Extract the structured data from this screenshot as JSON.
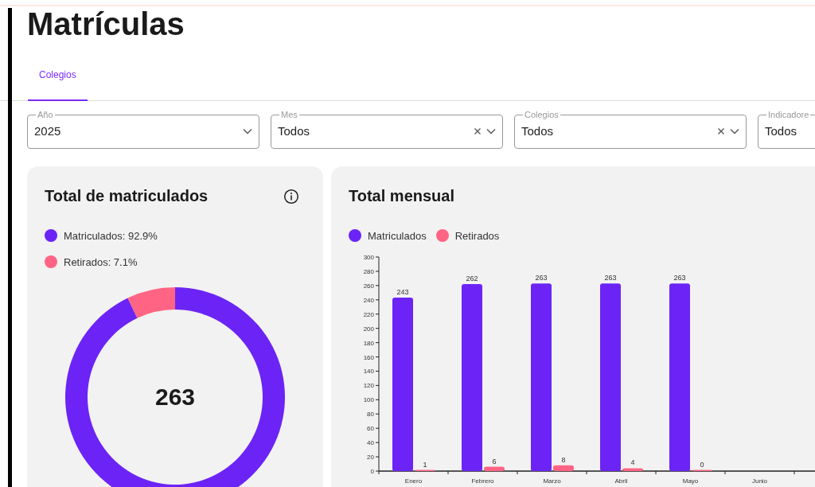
{
  "page": {
    "title": "Matrículas"
  },
  "tabs": [
    {
      "label": "Colegios",
      "selected": true
    }
  ],
  "filters": [
    {
      "label": "Año",
      "value": "2025",
      "clearable": false,
      "dropdown": true
    },
    {
      "label": "Mes",
      "value": "Todos",
      "clearable": true,
      "dropdown": true
    },
    {
      "label": "Colegios",
      "value": "Todos",
      "clearable": true,
      "dropdown": true
    },
    {
      "label": "Indicadore",
      "value": "Todos"
    }
  ],
  "total_card": {
    "title": "Total de matriculados",
    "center_value": "263",
    "legend": [
      {
        "color": "#6b24f5"
      },
      {
        "color": "#ff6484"
      }
    ],
    "chart_data": {
      "type": "donut",
      "categories": [
        "Matriculados: 92.9%",
        "Retirados: 7.1%"
      ],
      "values": [
        92.9,
        7.1
      ]
    }
  },
  "monthly_card": {
    "title": "Total mensual",
    "chart_data": {
      "type": "bar",
      "categories": [
        "Enero",
        "Febrero",
        "Marzo",
        "Abril",
        "Mayo",
        "Junio"
      ],
      "series": [
        {
          "name": "Matriculados",
          "color": "#6b24f5",
          "values": [
            243,
            262,
            263,
            263,
            263,
            null
          ]
        },
        {
          "name": "Retirados",
          "color": "#ff6484",
          "values": [
            1,
            6,
            8,
            4,
            0,
            null
          ]
        }
      ],
      "ylim": [
        0,
        300
      ],
      "yticks": [
        0,
        20,
        40,
        60,
        80,
        100,
        120,
        140,
        160,
        180,
        200,
        220,
        240,
        260,
        280,
        300
      ],
      "data_labels": true
    }
  }
}
